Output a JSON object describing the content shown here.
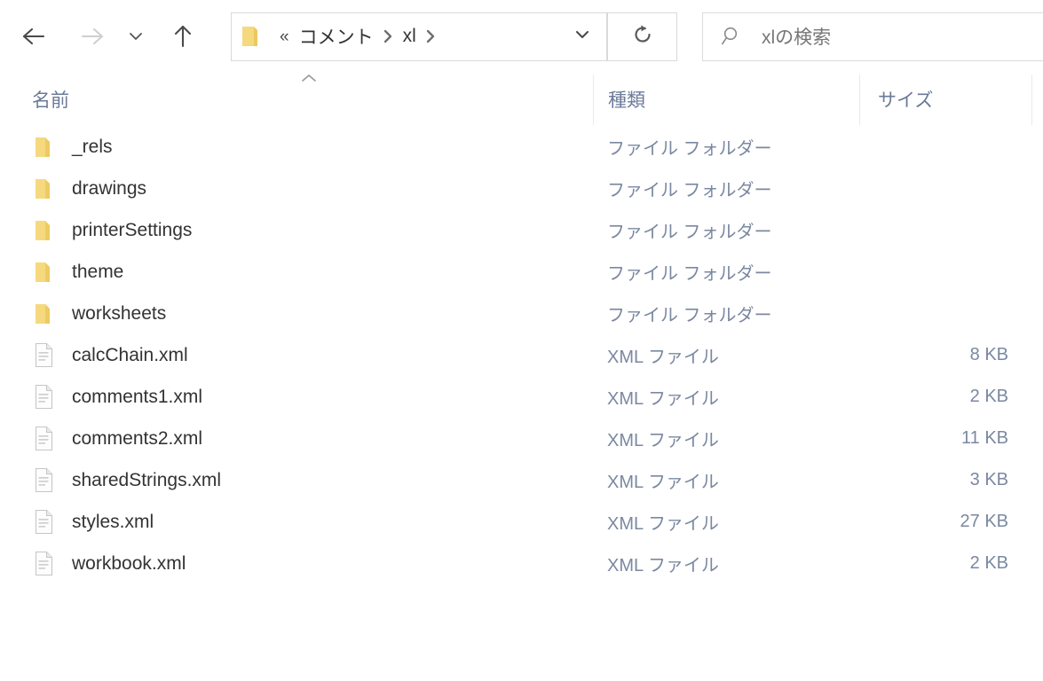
{
  "toolbar": {
    "back_label": "back-arrow",
    "forward_label": "forward-arrow",
    "recent_label": "recent-locations",
    "up_label": "up-arrow",
    "refresh_label": "refresh",
    "address_dropdown_label": "address-dropdown"
  },
  "address": {
    "overflow": "«",
    "separator": "›",
    "crumbs": [
      {
        "label": "コメント"
      },
      {
        "label": "xl"
      }
    ]
  },
  "search": {
    "placeholder": "xlの検索",
    "value": "xlの検索"
  },
  "columns": {
    "name": "名前",
    "type": "種類",
    "size": "サイズ",
    "sorted_by": "名前",
    "sort_direction": "ascending"
  },
  "labels": {
    "folder_type": "ファイル フォルダー",
    "xml_type": "XML ファイル"
  },
  "colors": {
    "folder_icon": "#f7d77a",
    "header_text": "#6b7a99",
    "row_text": "#333333",
    "meta_text": "#7b88a1",
    "border": "#dcdcdc"
  },
  "files": [
    {
      "name": "_rels",
      "icon": "folder-icon",
      "type": "ファイル フォルダー",
      "size": ""
    },
    {
      "name": "drawings",
      "icon": "folder-icon",
      "type": "ファイル フォルダー",
      "size": ""
    },
    {
      "name": "printerSettings",
      "icon": "folder-icon",
      "type": "ファイル フォルダー",
      "size": ""
    },
    {
      "name": "theme",
      "icon": "folder-icon",
      "type": "ファイル フォルダー",
      "size": ""
    },
    {
      "name": "worksheets",
      "icon": "folder-icon",
      "type": "ファイル フォルダー",
      "size": ""
    },
    {
      "name": "calcChain.xml",
      "icon": "xml-file-icon",
      "type": "XML ファイル",
      "size": "8 KB"
    },
    {
      "name": "comments1.xml",
      "icon": "xml-file-icon",
      "type": "XML ファイル",
      "size": "2 KB"
    },
    {
      "name": "comments2.xml",
      "icon": "xml-file-icon",
      "type": "XML ファイル",
      "size": "11 KB"
    },
    {
      "name": "sharedStrings.xml",
      "icon": "xml-file-icon",
      "type": "XML ファイル",
      "size": "3 KB"
    },
    {
      "name": "styles.xml",
      "icon": "xml-file-icon",
      "type": "XML ファイル",
      "size": "27 KB"
    },
    {
      "name": "workbook.xml",
      "icon": "xml-file-icon",
      "type": "XML ファイル",
      "size": "2 KB"
    }
  ]
}
